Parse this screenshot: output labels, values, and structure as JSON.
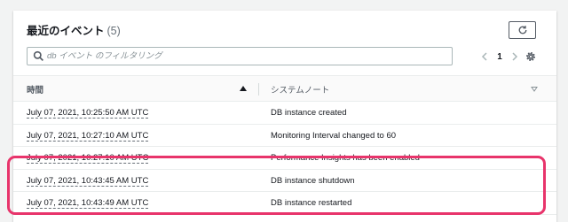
{
  "header": {
    "title": "最近のイベント",
    "count": "(5)"
  },
  "search": {
    "placeholder": "db イベント のフィルタリング"
  },
  "pagination": {
    "current_page": "1"
  },
  "table": {
    "columns": [
      "時間",
      "システムノート"
    ],
    "rows": [
      {
        "time": "July 07, 2021, 10:25:50 AM UTC",
        "note": "DB instance created"
      },
      {
        "time": "July 07, 2021, 10:27:10 AM UTC",
        "note": "Monitoring Interval changed to 60"
      },
      {
        "time": "July 07, 2021, 10:27:10 AM UTC",
        "note": "Performance Insights has been enabled"
      },
      {
        "time": "July 07, 2021, 10:43:45 AM UTC",
        "note": "DB instance shutdown"
      },
      {
        "time": "July 07, 2021, 10:43:49 AM UTC",
        "note": "DB instance restarted"
      }
    ]
  },
  "icons": {
    "refresh": "refresh-icon",
    "search": "search-icon",
    "prev": "chevron-left-icon",
    "next": "chevron-right-icon",
    "settings": "gear-icon",
    "sort_asc": "caret-up-icon",
    "sort_desc": "caret-down-icon"
  },
  "colors": {
    "highlight": "#e8346b",
    "panel_bg": "#ffffff",
    "page_bg": "#f2f3f3"
  }
}
